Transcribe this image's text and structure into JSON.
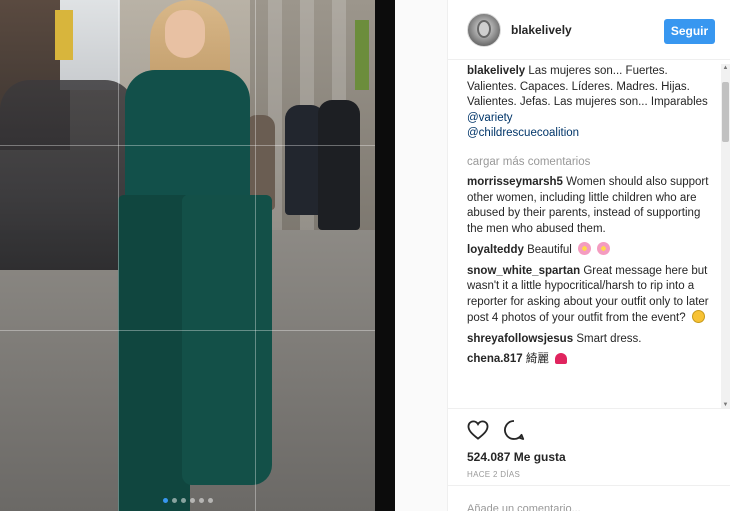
{
  "post": {
    "username": "blakelively",
    "follow_label": "Seguir",
    "caption_user": "blakelively",
    "caption_text": "Las mujeres son... Fuertes. Valientes. Capaces. Líderes. Madres. Hijas. Valientes. Jefas. Las mujeres son... Imparables",
    "caption_mention1": "@variety",
    "caption_mention2": "@childrescuecoalition",
    "load_more": "cargar más comentarios",
    "likes": "524.087 Me gusta",
    "time": "HACE 2 DÍAS",
    "add_comment_placeholder": "Añade un comentario..."
  },
  "comments": [
    {
      "user": "morrisseymarsh5",
      "text": "Women should also support other women, including little children who are abused by their parents, instead of supporting the men who abused them."
    },
    {
      "user": "loyalteddy",
      "text": "Beautiful"
    },
    {
      "user": "snow_white_spartan",
      "text": "Great message here but wasn't it a little hypocritical/harsh to rip into a reporter for asking about your outfit only to later post 4 photos of your outfit from the event?"
    },
    {
      "user": "shreyafollowsjesus",
      "text": "Smart dress."
    },
    {
      "user": "chena.817",
      "text": "綺麗"
    }
  ],
  "icons": {
    "like": "heart-icon",
    "comment": "comment-icon",
    "scroll_up": "arrow-up-icon",
    "scroll_down": "arrow-down-icon"
  },
  "colors": {
    "accent": "#3897f0",
    "mention": "#003569",
    "muted": "#999999"
  },
  "carousel": {
    "slides": 6,
    "active": 1
  }
}
